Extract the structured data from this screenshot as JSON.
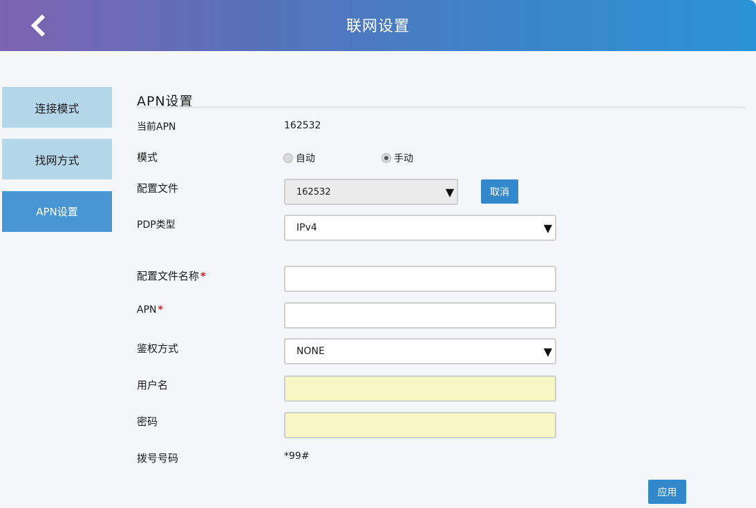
{
  "header": {
    "title": "联网设置",
    "back_icon": "chevron-left-icon"
  },
  "sidebar": {
    "items": [
      {
        "label": "连接模式"
      },
      {
        "label": "找网方式"
      },
      {
        "label": "APN设置"
      }
    ]
  },
  "section": {
    "title": "APN设置"
  },
  "form": {
    "current_apn": {
      "label": "当前APN",
      "value": "162532"
    },
    "mode": {
      "label": "模式",
      "options": [
        "自动",
        "手动"
      ],
      "selected": "手动"
    },
    "profile": {
      "label": "配置文件",
      "value": "162532",
      "cancel_label": "取消"
    },
    "pdp_type": {
      "label": "PDP类型",
      "value": "IPv4"
    },
    "profile_name": {
      "label": "配置文件名称",
      "required_mark": "*",
      "value": ""
    },
    "apn": {
      "label": "APN",
      "required_mark": "*",
      "value": ""
    },
    "auth": {
      "label": "鉴权方式",
      "value": "NONE"
    },
    "username": {
      "label": "用户名",
      "value": ""
    },
    "password": {
      "label": "密码",
      "value": ""
    },
    "dial_number": {
      "label": "拨号号码",
      "value": "*99#"
    },
    "apply_label": "应用"
  },
  "colors": {
    "accent": "#3388cc",
    "sidebar_active": "#4796d3",
    "sidebar_inactive": "#b5d7ea",
    "required": "#d21d1d",
    "highlight_input": "#f6f7c2"
  }
}
